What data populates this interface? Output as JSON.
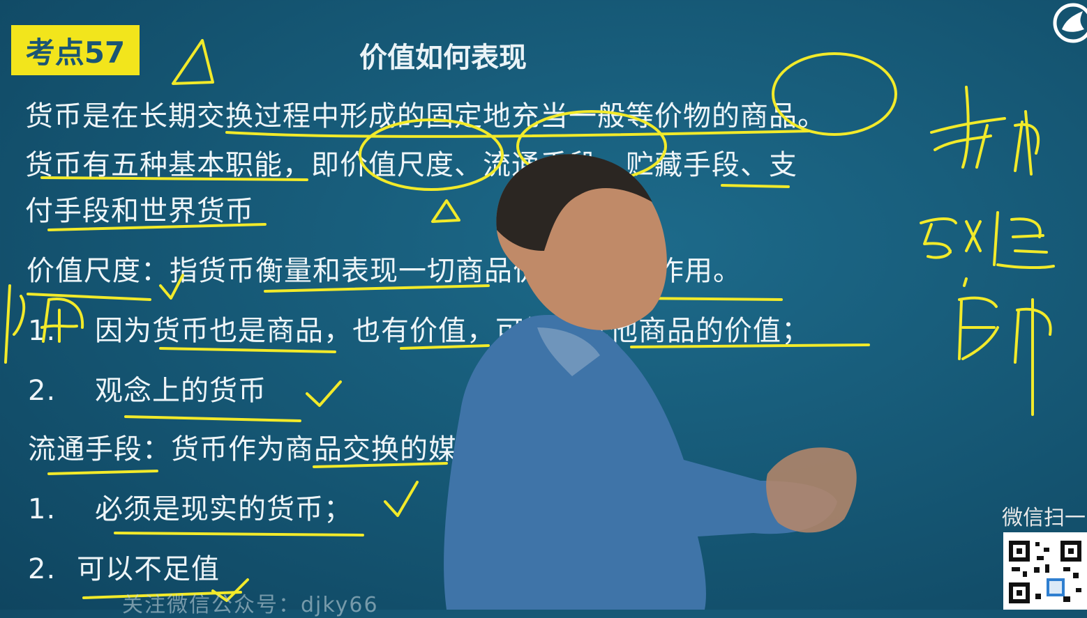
{
  "badge": "考点57",
  "title": "价值如何表现",
  "lines": {
    "l1": "货币是在长期交换过程中形成的固定地充当一般等价物的商品。",
    "l2": "货币有五种基本职能，即价值尺度、流通手段、贮藏手段、支",
    "l3": "付手段和世界货币",
    "l4": "价值尺度：指货币衡量和表现一切商品价值大小的作用。",
    "l5_num": "1.",
    "l5": "因为货币也是商品，也有价值，可衡量其他商品的价值；",
    "l6_num": "2.",
    "l6": "观念上的货币",
    "l7": "流通手段：货币作为商品交换的媒介的作用。",
    "l8_num": "1.",
    "l8": "必须是现实的货币；",
    "l9_num": "2.",
    "l9": "可以不足值"
  },
  "watermark": "关注微信公众号：djky66",
  "wechat_scan": "微信扫一",
  "colors": {
    "board": "#155673",
    "chalk_yellow": "#f2ea2a",
    "badge_bg": "#f2e51c"
  }
}
